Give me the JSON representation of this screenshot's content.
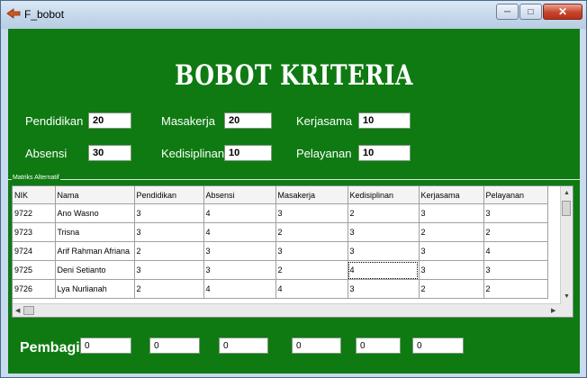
{
  "window": {
    "title": "F_bobot"
  },
  "heading": "BOBOT KRITERIA",
  "criteria": {
    "pendidikan": {
      "label": "Pendidikan",
      "value": "20"
    },
    "masakerja": {
      "label": "Masakerja",
      "value": "20"
    },
    "kerjasama": {
      "label": "Kerjasama",
      "value": "10"
    },
    "absensi": {
      "label": "Absensi",
      "value": "30"
    },
    "kedisiplinan": {
      "label": "Kedisiplinan",
      "value": "10"
    },
    "pelayanan": {
      "label": "Pelayanan",
      "value": "10"
    }
  },
  "group_label": "Matriks Alternatif",
  "table": {
    "columns": [
      "NIK",
      "Nama",
      "Pendidikan",
      "Absensi",
      "Masakerja",
      "Kedisiplinan",
      "Kerjasama",
      "Pelayanan"
    ],
    "rows": [
      [
        "9722",
        "Ano Wasno",
        "3",
        "4",
        "3",
        "2",
        "3",
        "3"
      ],
      [
        "9723",
        "Trisna",
        "3",
        "4",
        "2",
        "3",
        "2",
        "2"
      ],
      [
        "9724",
        "Arif Rahman Afriana",
        "2",
        "3",
        "3",
        "3",
        "3",
        "4"
      ],
      [
        "9725",
        "Deni Setianto",
        "3",
        "3",
        "2",
        "4",
        "3",
        "3"
      ],
      [
        "9726",
        "Lya Nurlianah",
        "2",
        "4",
        "4",
        "3",
        "2",
        "2"
      ]
    ]
  },
  "pembagi": {
    "label": "Pembagi",
    "values": [
      "0",
      "0",
      "0",
      "0",
      "0",
      "0"
    ]
  }
}
